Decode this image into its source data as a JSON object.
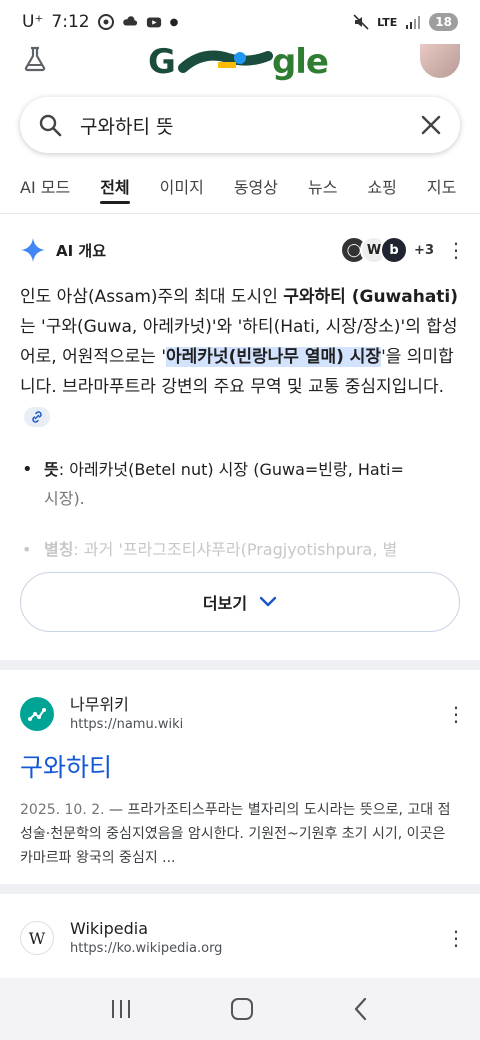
{
  "status": {
    "carrier": "U⁺",
    "time": "7:12",
    "network": "LTE",
    "battery": "18"
  },
  "search": {
    "query": "구와하티 뜻"
  },
  "tabs": [
    {
      "label": "AI 모드"
    },
    {
      "label": "전체"
    },
    {
      "label": "이미지"
    },
    {
      "label": "동영상"
    },
    {
      "label": "뉴스"
    },
    {
      "label": "쇼핑"
    },
    {
      "label": "지도"
    }
  ],
  "ai_overview": {
    "title": "AI 개요",
    "sources_extra": "+3",
    "p1": "인도 아삼(Assam)주의 최대 도시인 ",
    "p1_bold": "구와하티 (Guwahati)",
    "p2": "는 '구와(Guwa, 아레카넛)'와 '하티(Hati, 시장/장소)'의 합성어로, 어원적으로는 '",
    "p2_hl": "아레카넛(빈랑나무 열매) 시장",
    "p3": "'을 의미합니다. 브라마푸트라 강변의 주요 무역 및 교통 중심지입니다.",
    "bullet1_label": "뜻",
    "bullet1_text_a": ": 아레카넛(Betel nut) 시장 (Guwa=빈랑, Hati=",
    "bullet1_text_b": "시장).",
    "bullet2_label": "별칭",
    "bullet2_text": ": 과거 '프라그조티샤푸라(Pragjyotishpura, 별",
    "more_label": "더보기"
  },
  "results": [
    {
      "site_name": "나무위키",
      "url": "https://namu.wiki",
      "title": "구와하티",
      "date": "2025. 10. 2.",
      "snippet": " — 프라가조티스푸라는 별자리의 도시라는 뜻으로, 고대 점성술·천문학의 중심지였음을 암시한다. 기원전~기원후 초기 시기, 이곳은 카마르파 왕국의 중심지 ..."
    },
    {
      "site_name": "Wikipedia",
      "url": "https://ko.wikipedia.org"
    }
  ]
}
